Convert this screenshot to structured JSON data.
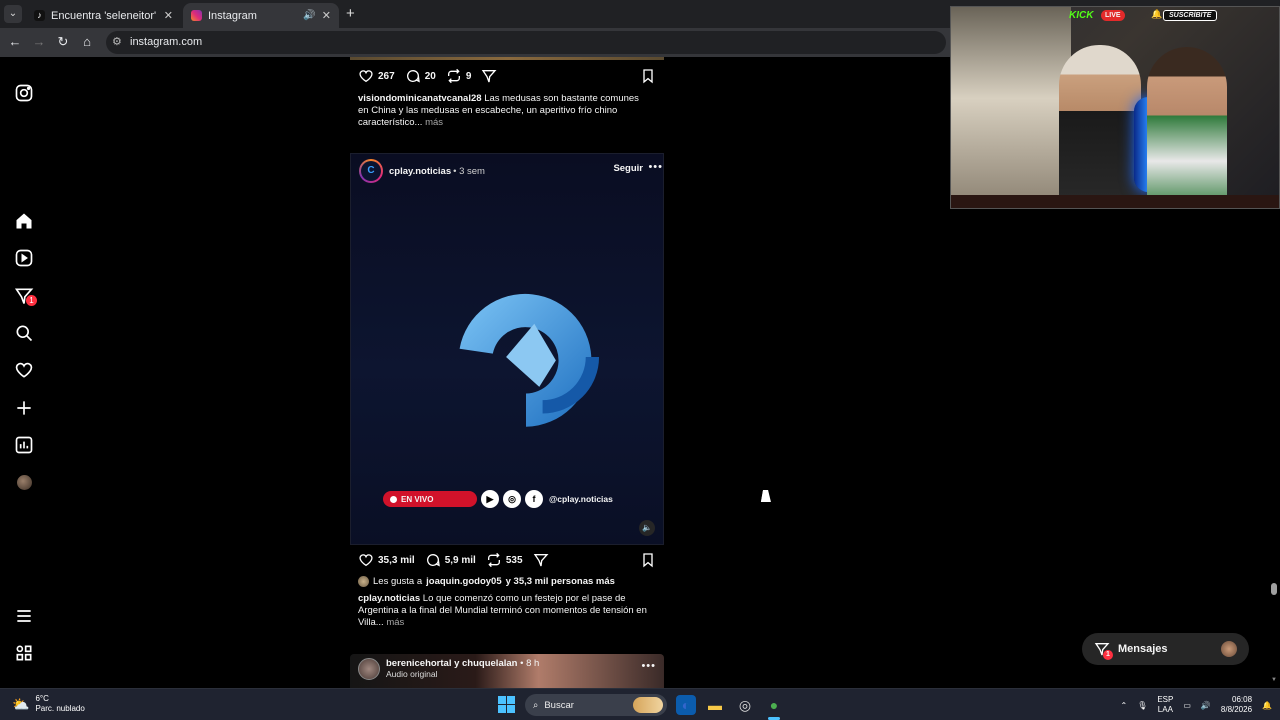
{
  "browser": {
    "tabs": [
      {
        "label": "Encuentra 'seleneitor' en TikTok",
        "active": false
      },
      {
        "label": "Instagram",
        "active": true
      }
    ],
    "url": "instagram.com"
  },
  "prev_post": {
    "likes": "267",
    "comments": "20",
    "reposts": "9",
    "username": "visiondominicanatvcanal28",
    "caption": "Las medusas son bastante comunes en China y las medusas en escabeche, un aperitivo frío chino característico...",
    "more": "más"
  },
  "post": {
    "username": "cplay.noticias",
    "time": "• 3 sem",
    "follow": "Seguir",
    "live_label": "EN VIVO",
    "handle": "@cplay.noticias",
    "likes": "35,3 mil",
    "comments": "5,9 mil",
    "reposts": "535",
    "liked_by_prefix": "Les gusta a",
    "liked_by_user": "joaquin.godoy05",
    "liked_by_suffix": "y 35,3 mil personas más",
    "caption": "Lo que comenzó como un festejo por el pase de Argentina a la final del Mundial terminó con momentos de tensión en Villa...",
    "more": "más"
  },
  "next_post": {
    "users": "berenicehortal y chuquelalan",
    "time": "• 8 h",
    "audio": "Audio original"
  },
  "messages": {
    "label": "Mensajes",
    "badge": "1"
  },
  "sidebar": {
    "notif_badge": "1"
  },
  "overlay": {
    "platform": "KICK",
    "live": "LIVE",
    "subscribe": "SUSCRÍBITE"
  },
  "taskbar": {
    "temp": "6°C",
    "weather": "Parc. nublado",
    "search": "Buscar",
    "lang1": "ESP",
    "lang2": "LAA",
    "time": "06:08",
    "date": "8/8/2026"
  },
  "colors": {
    "accent": "#0095f6",
    "live": "#d1122a",
    "badge": "#ff3040"
  }
}
